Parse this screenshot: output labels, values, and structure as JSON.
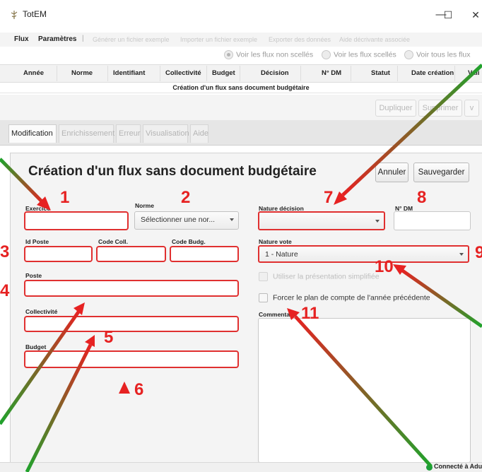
{
  "window": {
    "title": "TotEM",
    "minimize": "—",
    "maximize": "☐",
    "close": "✕"
  },
  "menubar": {
    "items": [
      "Flux",
      "Paramètres"
    ],
    "separator": "|",
    "disabled_items": [
      "Générer un fichier exemple",
      "Importer un fichier exemple",
      "Exporter des données",
      "Aide décrivante associée"
    ]
  },
  "filters": [
    {
      "label": "Voir les flux non scellés",
      "selected": true
    },
    {
      "label": "Voir les flux scellés",
      "selected": false
    },
    {
      "label": "Voir tous les flux",
      "selected": false
    }
  ],
  "table": {
    "columns": [
      "Année",
      "Norme",
      "Identifiant",
      "Collectivité",
      "Budget",
      "Décision",
      "N° DM",
      "Statut",
      "Date création",
      "Vali"
    ],
    "rows": [
      "Création d'un flux sans document budgétaire"
    ]
  },
  "toolbar": {
    "duplicate": "Dupliquer",
    "delete": "Supprimer",
    "more": "v"
  },
  "tabs": [
    {
      "label": "Modification",
      "active": true
    },
    {
      "label": "Enrichissement",
      "active": false
    },
    {
      "label": "Erreur",
      "active": false
    },
    {
      "label": "Visualisation",
      "active": false
    },
    {
      "label": "Aide",
      "active": false
    }
  ],
  "form": {
    "title": "Création d'un flux sans document budgétaire",
    "cancel": "Annuler",
    "save": "Sauvegarder",
    "labels": {
      "exercice": "Exercice",
      "norme": "Norme",
      "id_poste": "Id Poste",
      "code_coll": "Code Coll.",
      "code_budg": "Code Budg.",
      "poste": "Poste",
      "collectivite": "Collectivité",
      "budget": "Budget",
      "nature_decision": "Nature décision",
      "n_dm": "N° DM",
      "nature_vote": "Nature vote",
      "commentaire": "Commentaire"
    },
    "values": {
      "exercice": "",
      "norme": "Sélectionner une nor...",
      "id_poste": "",
      "code_coll": "",
      "code_budg": "",
      "poste": "",
      "collectivite": "",
      "budget": "",
      "nature_decision": "",
      "n_dm": "",
      "nature_vote": "1 - Nature",
      "commentaire": ""
    },
    "checkboxes": {
      "simplified": {
        "label": "Utiliser la présentation simplifiée",
        "checked": false,
        "enabled": false
      },
      "previous_plan": {
        "label": "Forcer le plan de compte de l'année précédente",
        "checked": false,
        "enabled": true
      }
    }
  },
  "annotations": [
    "1",
    "2",
    "3",
    "4",
    "5",
    "6",
    "7",
    "8",
    "9",
    "10",
    "11"
  ],
  "status": {
    "text": "Connecté à Adulla",
    "color": "#1f9e3a"
  },
  "colors": {
    "annotation_red": "#e62222",
    "arrow_green": "#1fa32c",
    "field_border": "#e03030"
  }
}
